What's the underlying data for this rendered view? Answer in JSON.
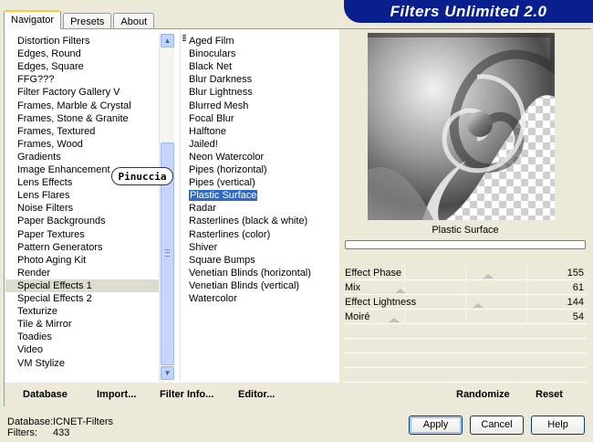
{
  "tabs": [
    {
      "label": "Navigator",
      "active": true
    },
    {
      "label": "Presets",
      "active": false
    },
    {
      "label": "About",
      "active": false
    }
  ],
  "banner_title": "Filters Unlimited 2.0",
  "categories": [
    "Distortion Filters",
    "Edges, Round",
    "Edges, Square",
    "FFG???",
    "Filter Factory Gallery V",
    "Frames, Marble & Crystal",
    "Frames, Stone & Granite",
    "Frames, Textured",
    "Frames, Wood",
    "Gradients",
    "Image Enhancement",
    "Lens Effects",
    "Lens Flares",
    "Noise Filters",
    "Paper Backgrounds",
    "Paper Textures",
    "Pattern Generators",
    "Photo Aging Kit",
    "Render",
    "Special Effects 1",
    "Special Effects 2",
    "Texturize",
    "Tile & Mirror",
    "Toadies",
    "Video",
    "VM Stylize"
  ],
  "selected_category": "Special Effects 1",
  "watermark": "Pinuccia",
  "filters": [
    "Aged Film",
    "Binoculars",
    "Black Net",
    "Blur Darkness",
    "Blur Lightness",
    "Blurred Mesh",
    "Focal Blur",
    "Halftone",
    "Jailed!",
    "Neon Watercolor",
    "Pipes (horizontal)",
    "Pipes (vertical)",
    "Plastic Surface",
    "Radar",
    "Rasterlines (black & white)",
    "Rasterlines (color)",
    "Shiver",
    "Square Bumps",
    "Venetian Blinds (horizontal)",
    "Venetian Blinds (vertical)",
    "Watercolor"
  ],
  "selected_filter": "Plastic Surface",
  "preview_title": "Plastic Surface",
  "params": [
    {
      "name": "Effect Phase",
      "value": 155,
      "max": 255
    },
    {
      "name": "Mix",
      "value": 61,
      "max": 255
    },
    {
      "name": "Effect Lightness",
      "value": 144,
      "max": 255
    },
    {
      "name": "Moiré",
      "value": 54,
      "max": 255
    }
  ],
  "toolbar": {
    "database": "Database",
    "import": "Import...",
    "filter_info": "Filter Info...",
    "editor": "Editor...",
    "randomize": "Randomize",
    "reset": "Reset"
  },
  "info": {
    "database_label": "Database:",
    "database_value": "ICNET-Filters",
    "filters_label": "Filters:",
    "filters_value": "433"
  },
  "buttons": {
    "apply": "Apply",
    "cancel": "Cancel",
    "help": "Help"
  },
  "colors": {
    "banner": "#0a1f8e",
    "selection": "#316ac5"
  },
  "icons": {
    "scroll_up": "chevron-up-icon",
    "scroll_down": "chevron-down-icon"
  }
}
